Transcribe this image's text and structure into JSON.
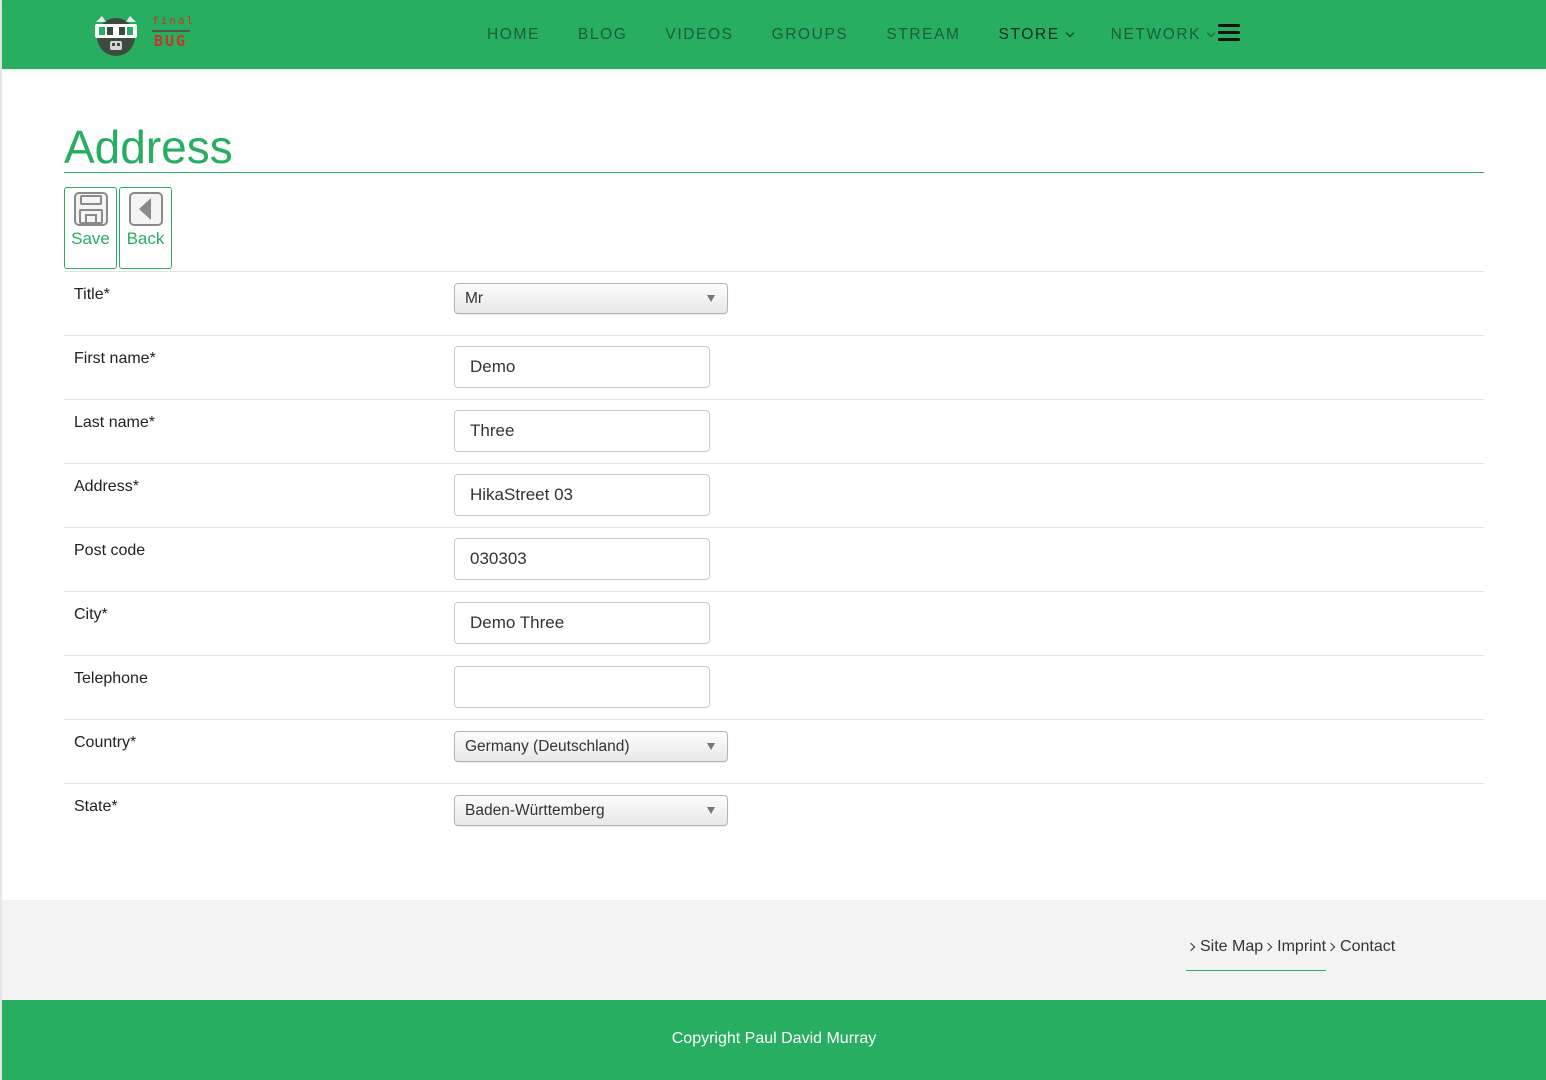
{
  "header": {
    "logo": {
      "top_text": "final",
      "main_text": "BUG"
    },
    "nav": [
      {
        "label": "HOME",
        "dropdown": false
      },
      {
        "label": "BLOG",
        "dropdown": false
      },
      {
        "label": "VIDEOS",
        "dropdown": false
      },
      {
        "label": "GROUPS",
        "dropdown": false
      },
      {
        "label": "STREAM",
        "dropdown": false
      },
      {
        "label": "STORE",
        "dropdown": true
      },
      {
        "label": "NETWORK",
        "dropdown": true
      }
    ],
    "menu_icon": "hamburger-icon"
  },
  "page": {
    "title": "Address"
  },
  "toolbar": {
    "save_label": "Save",
    "save_icon": "floppy-disk-icon",
    "back_label": "Back",
    "back_icon": "back-arrow-icon"
  },
  "form": {
    "fields": [
      {
        "label": "Title*",
        "type": "select",
        "value": "Mr"
      },
      {
        "label": "First name*",
        "type": "text",
        "value": "Demo"
      },
      {
        "label": "Last name*",
        "type": "text",
        "value": "Three"
      },
      {
        "label": "Address*",
        "type": "text",
        "value": "HikaStreet 03"
      },
      {
        "label": "Post code",
        "type": "text",
        "value": "030303"
      },
      {
        "label": "City*",
        "type": "text",
        "value": "Demo Three"
      },
      {
        "label": "Telephone",
        "type": "text",
        "value": ""
      },
      {
        "label": "Country*",
        "type": "select",
        "value": "Germany (Deutschland)"
      },
      {
        "label": "State*",
        "type": "select",
        "value": "Baden-Württemberg"
      }
    ]
  },
  "footer": {
    "links": [
      {
        "label": "Site Map"
      },
      {
        "label": "Imprint"
      },
      {
        "label": "Contact"
      }
    ],
    "copyright": "Copyright Paul David Murray"
  },
  "colors": {
    "brand_green": "#27ae60",
    "logo_red": "#c0392b",
    "footer_band": "#f3f3f3"
  }
}
